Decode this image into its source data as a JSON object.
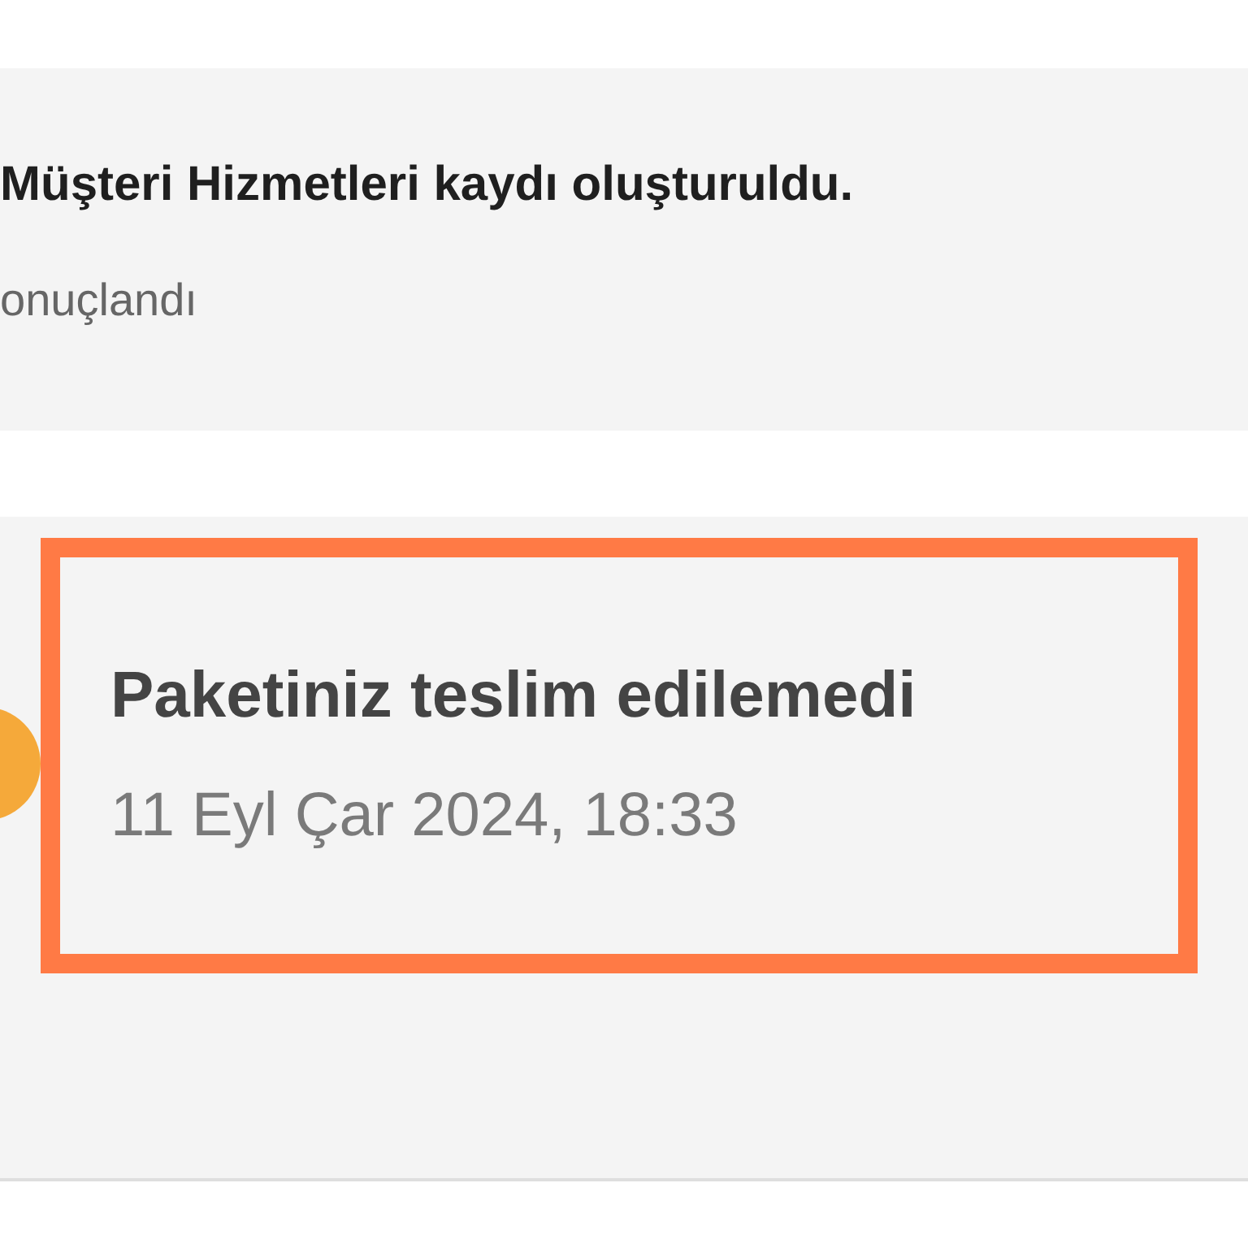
{
  "events": [
    {
      "title": "Müşteri Hizmetleri kaydı oluşturuldu.",
      "subtitle": "onuçlandı",
      "highlighted": false
    },
    {
      "title": "Paketiniz teslim edilemedi",
      "subtitle": "11 Eyl Çar 2024, 18:33",
      "highlighted": true,
      "color": "#f5a93a"
    }
  ]
}
